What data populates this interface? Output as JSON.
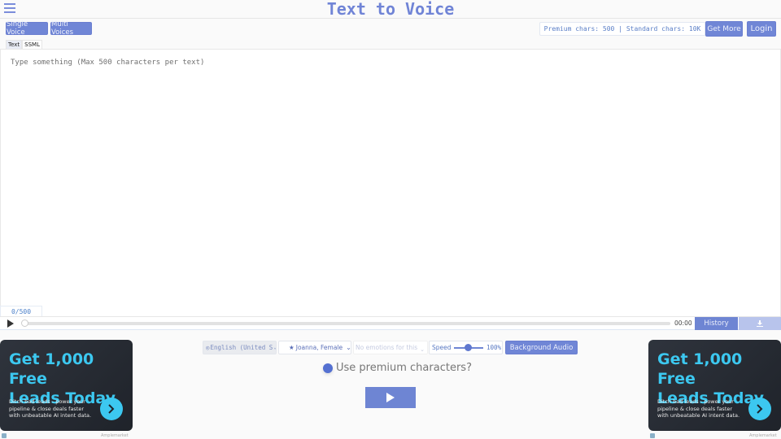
{
  "header": {
    "title": "Text to Voice"
  },
  "mode_buttons": {
    "single": "Single Voice",
    "multi": "Multi Voices"
  },
  "quota": {
    "text": "Premium chars: 500 | Standard chars: 10K",
    "get_more": "Get More",
    "login": "Login"
  },
  "tabs": [
    {
      "label": "Text",
      "active": true
    },
    {
      "label": "SSML",
      "active": false
    }
  ],
  "editor": {
    "placeholder": "Type something (Max 500 characters per text)",
    "value": "",
    "counter": "0/500"
  },
  "player": {
    "time": "00:00",
    "progress": 0,
    "history_label": "History",
    "download_icon": "download-icon"
  },
  "controls": {
    "language": "English (United States)",
    "language_display": "English (United S",
    "voice": "Joanna, Female",
    "emotion": "No emotions for this",
    "speed_label": "Speed",
    "speed_value": "100%",
    "speed_fraction": 0.5,
    "background_audio": "Background Audio",
    "premium_question": "Use premium characters?"
  },
  "ads": [
    {
      "headline_1": "Get 1,000 Free",
      "headline_2": "Leads Today",
      "body": "Ditch bad leads - power your pipeline & close deals faster with unbeatable AI intent data.",
      "sponsor": "Amplemarket"
    },
    {
      "headline_1": "Get 1,000 Free",
      "headline_2": "Leads Today",
      "body": "Ditch bad leads - power your pipeline & close deals faster with unbeatable AI intent data.",
      "sponsor": "Amplemarket"
    }
  ],
  "colors": {
    "accent": "#7086d6",
    "ad_cyan": "#3cc8f0",
    "ad_bg": "#2a2e36"
  }
}
